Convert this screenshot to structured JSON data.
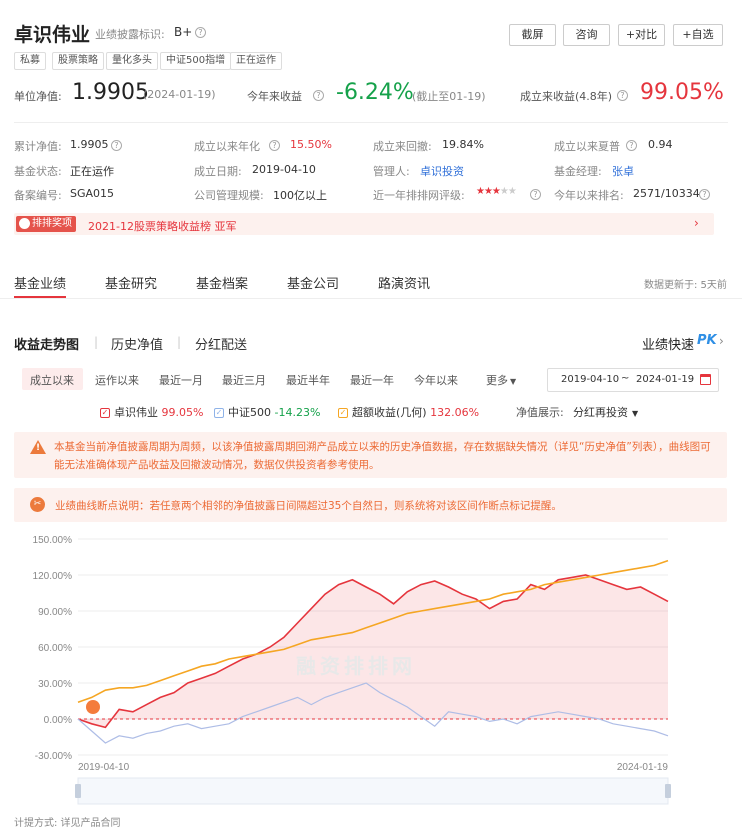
{
  "header": {
    "fund_name": "卓识伟业",
    "rating_label": "业绩披露标识:",
    "rating_value": "B+",
    "tags": [
      "私募",
      "股票策略",
      "量化多头",
      "中证500指增",
      "正在运作"
    ],
    "buttons": [
      "截屏",
      "咨询",
      "+对比",
      "+自选"
    ]
  },
  "summary": {
    "nav_label": "单位净值:",
    "nav_value": "1.9905",
    "nav_date": "(2024-01-19)",
    "ytd_label": "今年来收益",
    "ytd_value": "-6.24%",
    "ytd_note": "(截止至01-19)",
    "since_label": "成立来收益(4.8年)",
    "since_value": "99.05%"
  },
  "details": [
    {
      "label": "累计净值:",
      "value": "1.9905"
    },
    {
      "label": "成立以来年化",
      "value": "15.50%"
    },
    {
      "label": "成立来回撤:",
      "value": "19.84%"
    },
    {
      "label": "成立以来夏普",
      "value": "0.94"
    },
    {
      "label": "基金状态:",
      "value": "正在运作"
    },
    {
      "label": "成立日期:",
      "value": "2019-04-10"
    },
    {
      "label": "管理人:",
      "value": "卓识投资"
    },
    {
      "label": "基金经理:",
      "value": "张卓"
    },
    {
      "label": "备案编号:",
      "value": "SGA015"
    },
    {
      "label": "公司管理规模:",
      "value": "100亿以上"
    },
    {
      "label": "近一年排排网评级:",
      "value": "★★★★★",
      "stars": 3
    },
    {
      "label": "今年以来排名:",
      "value": "2571/10334"
    }
  ],
  "award": {
    "badge": "排排奖项",
    "text": "2021-12股票策略收益榜 亚军"
  },
  "main_tabs": [
    "基金业绩",
    "基金研究",
    "基金档案",
    "基金公司",
    "路演资讯"
  ],
  "update_note": "数据更新于: 5天前",
  "sub_tabs": [
    "收益走势图",
    "历史净值",
    "分红配送"
  ],
  "pk_label": "业绩快速",
  "pk_badge": "PK",
  "periods": [
    "成立以来",
    "运作以来",
    "最近一月",
    "最近三月",
    "最近半年",
    "最近一年",
    "今年以来",
    "更多"
  ],
  "date_range": {
    "start": "2019-04-10",
    "sep": "~",
    "end": "2024-01-19"
  },
  "legend": {
    "fund": {
      "name": "卓识伟业",
      "value": "99.05%"
    },
    "index": {
      "name": "中证500",
      "value": "-14.23%"
    },
    "excess": {
      "name": "超额收益(几何)",
      "value": "132.06%"
    },
    "display_label": "净值展示:",
    "display_value": "分红再投资"
  },
  "warning": "本基金当前净值披露周期为周频，以该净值披露周期回溯产品成立以来的历史净值数据，存在数据缺失情况（详见“历史净值”列表），曲线图可能无法准确体现产品收益及回撤波动情况，数据仅供投资者参考使用。",
  "notice": "业绩曲线断点说明：若任意两个相邻的净值披露日间隔超过35个自然日，则系统将对该区间作断点标记提醒。",
  "watermark": "融资排排网",
  "footer": "计提方式:  详见产品合同",
  "colors": {
    "fund": "#e5353d",
    "index": "#aebde6",
    "excess": "#f5a623",
    "accent": "#e5353d"
  },
  "chart_data": {
    "type": "line",
    "x_range": [
      "2019-04-10",
      "2024-01-19"
    ],
    "x_tick_labels": [
      "2019-04-10",
      "2024-01-19"
    ],
    "ylim": [
      -30,
      150
    ],
    "y_ticks": [
      "150.00%",
      "120.00%",
      "90.00%",
      "60.00%",
      "30.00%",
      "0.00%",
      "-30.00%"
    ],
    "y_tick_values": [
      150,
      120,
      90,
      60,
      30,
      0,
      -30
    ],
    "series": [
      {
        "name": "卓识伟业",
        "values": [
          0,
          -4,
          -7,
          8,
          6,
          12,
          18,
          22,
          30,
          34,
          38,
          44,
          50,
          54,
          60,
          68,
          80,
          92,
          104,
          112,
          116,
          110,
          104,
          96,
          106,
          112,
          115,
          110,
          104,
          100,
          92,
          98,
          100,
          112,
          108,
          116,
          118,
          120,
          116,
          112,
          108,
          110,
          104,
          98
        ]
      },
      {
        "name": "中证500",
        "values": [
          0,
          -10,
          -20,
          -14,
          -16,
          -12,
          -10,
          -6,
          -4,
          -8,
          -6,
          -4,
          2,
          6,
          10,
          14,
          18,
          12,
          18,
          22,
          26,
          30,
          22,
          16,
          10,
          2,
          -6,
          6,
          4,
          2,
          -2,
          0,
          -4,
          2,
          4,
          6,
          4,
          2,
          0,
          -4,
          -6,
          -8,
          -10,
          -14
        ]
      },
      {
        "name": "超额收益(几何)",
        "values": [
          14,
          18,
          24,
          26,
          26,
          28,
          32,
          36,
          40,
          44,
          46,
          50,
          52,
          54,
          56,
          58,
          62,
          66,
          68,
          70,
          72,
          76,
          80,
          84,
          88,
          90,
          92,
          94,
          96,
          98,
          100,
          104,
          106,
          108,
          112,
          114,
          116,
          118,
          120,
          122,
          124,
          126,
          128,
          132
        ]
      }
    ]
  }
}
